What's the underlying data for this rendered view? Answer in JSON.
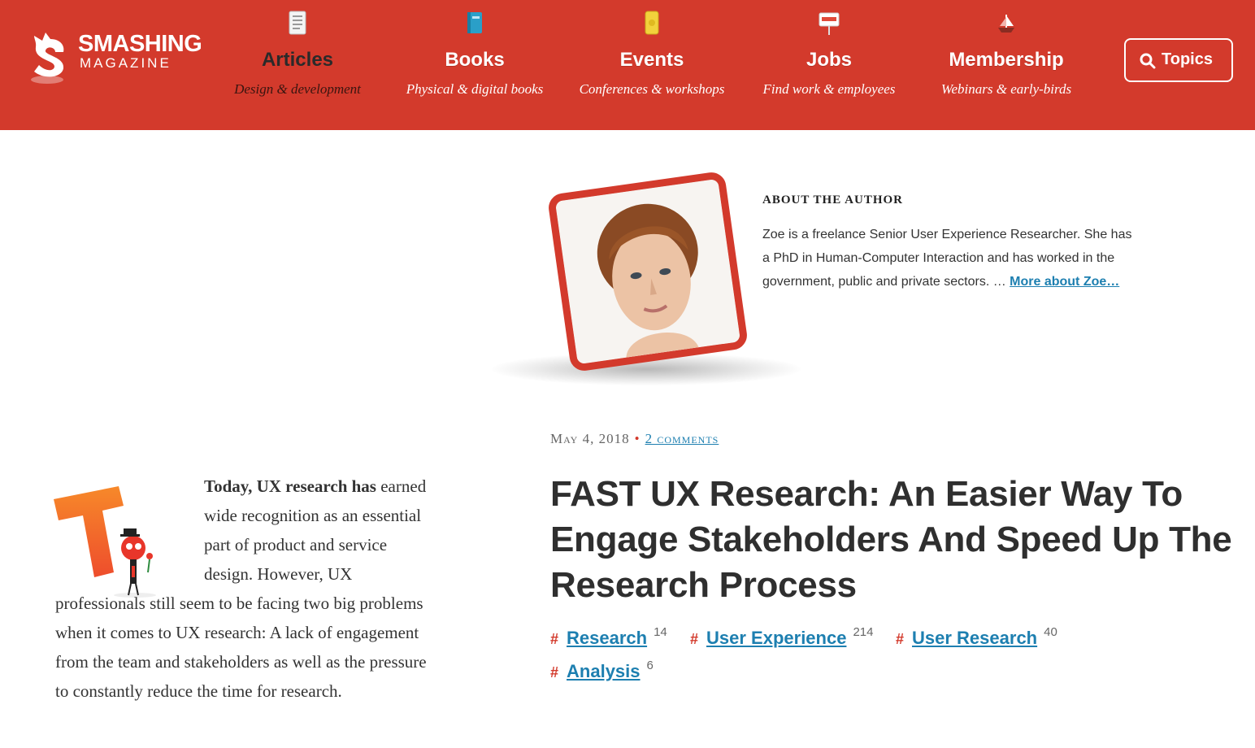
{
  "logo": {
    "title": "SMASHING",
    "subtitle": "MAGAZINE"
  },
  "nav": {
    "items": [
      {
        "title": "Articles",
        "subtitle": "Design & development",
        "icon": "article-icon",
        "active": true
      },
      {
        "title": "Books",
        "subtitle": "Physical & digital books",
        "icon": "book-icon"
      },
      {
        "title": "Events",
        "subtitle": "Conferences & workshops",
        "icon": "ticket-icon"
      },
      {
        "title": "Jobs",
        "subtitle": "Find work & employees",
        "icon": "open-sign-icon"
      },
      {
        "title": "Membership",
        "subtitle": "Webinars & early-birds",
        "icon": "boat-icon"
      }
    ],
    "topics_label": "Topics"
  },
  "author": {
    "heading": "ABOUT THE AUTHOR",
    "bio": "Zoe is a freelance Senior User Experience Researcher. She has a PhD in Human-Computer Interaction and has worked in the government, public and private sectors. … ",
    "more_link": "More about Zoe…"
  },
  "article": {
    "date": "May 4, 2018",
    "comments": "2 comments",
    "title": "FAST UX Research: An Easier Way To Engage Stakeholders And Speed Up The Research Process",
    "tags": [
      {
        "label": "Research",
        "count": "14"
      },
      {
        "label": "User Experience",
        "count": "214"
      },
      {
        "label": "User Research",
        "count": "40"
      },
      {
        "label": "Analysis",
        "count": "6"
      }
    ],
    "intro_bold": "Today, UX research has",
    "intro_rest": " earned wide recognition as an essential part of product and service design. However, UX professionals still seem to be facing two big problems when it comes to UX research: A lack of engagement from the team and stakeholders as well as the pressure to constantly reduce the time for research."
  },
  "colors": {
    "brand": "#d33a2c",
    "link": "#1d7fb0",
    "text": "#333333"
  }
}
